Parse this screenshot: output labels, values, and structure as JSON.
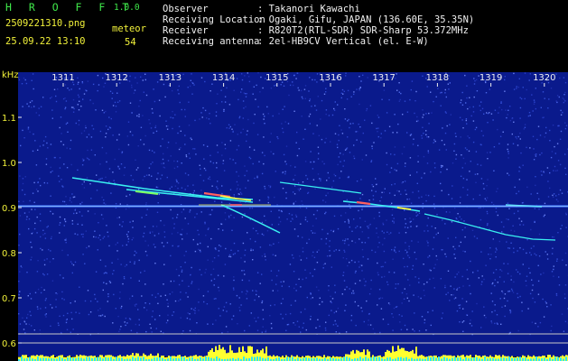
{
  "header": {
    "title": "H R O F F T",
    "version": "1.0.0",
    "filename": "2509221310.png",
    "timestamp": "25.09.22 13:10",
    "meteor_label": "meteor",
    "meteor_count": "54"
  },
  "info": [
    {
      "key": "Observer",
      "value": ": Takanori Kawachi"
    },
    {
      "key": "Receiving Location",
      "value": ": Ogaki, Gifu, JAPAN (136.60E, 35.35N)"
    },
    {
      "key": "Receiver",
      "value": ": R820T2(RTL-SDR) SDR-Sharp 53.372MHz"
    },
    {
      "key": "Receiving antenna",
      "value": ": 2el-HB9CV Vertical (el. E-W)"
    }
  ],
  "chart_data": {
    "type": "heatmap",
    "ylabel": "kHz",
    "x_ticks": [
      "1311",
      "1312",
      "1313",
      "1314",
      "1315",
      "1316",
      "1317",
      "1318",
      "1319",
      "1320"
    ],
    "y_ticks": [
      "1.1",
      "1.0",
      "0.9",
      "0.8",
      "0.7",
      "0.6"
    ],
    "background_color": "#0a1a8c",
    "label_color": "#f2f23a",
    "tick_color": "#f0f0f0",
    "signal_colors": [
      "#3af0f0",
      "#ffff40",
      "#ff5050"
    ]
  }
}
